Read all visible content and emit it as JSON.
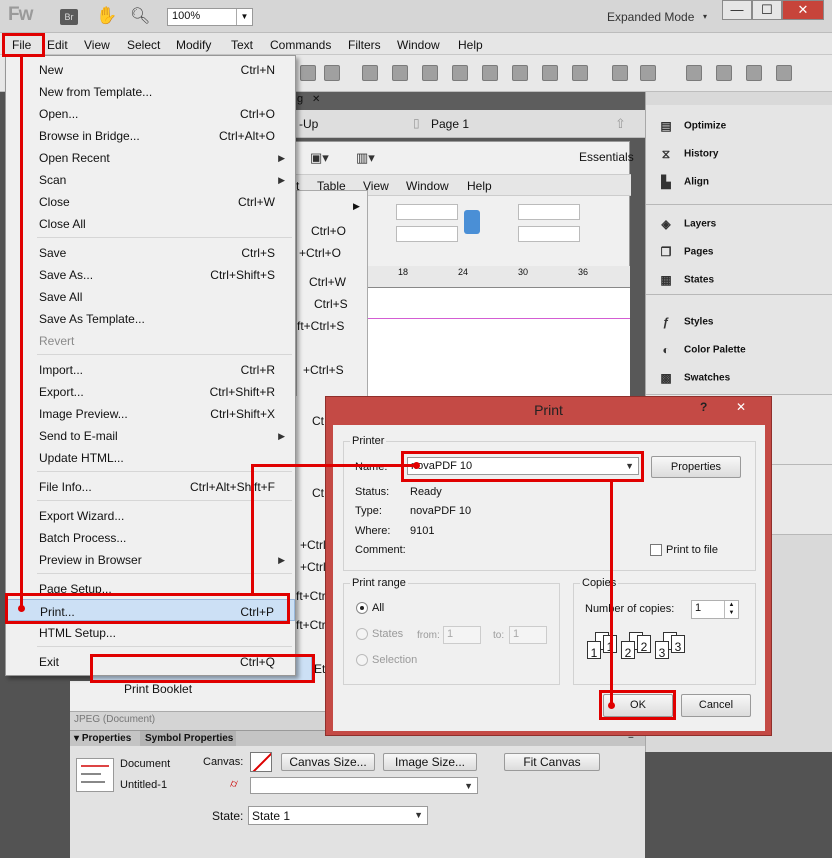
{
  "app": {
    "logo": "Fw",
    "bridge_badge": "Br",
    "zoom": "100%",
    "workspace_mode": "Expanded Mode",
    "window_buttons": {
      "minimize": "—",
      "maximize": "☐",
      "close": "✕"
    }
  },
  "menubar": [
    "File",
    "Edit",
    "View",
    "Select",
    "Modify",
    "Text",
    "Commands",
    "Filters",
    "Window",
    "Help"
  ],
  "file_menu": {
    "groups": [
      [
        {
          "label": "New",
          "shortcut": "Ctrl+N"
        },
        {
          "label": "New from Template...",
          "shortcut": ""
        },
        {
          "label": "Open...",
          "shortcut": "Ctrl+O"
        },
        {
          "label": "Browse in Bridge...",
          "shortcut": "Ctrl+Alt+O"
        },
        {
          "label": "Open Recent",
          "shortcut": "",
          "submenu": true
        },
        {
          "label": "Scan",
          "shortcut": "",
          "submenu": true
        },
        {
          "label": "Close",
          "shortcut": "Ctrl+W"
        },
        {
          "label": "Close All",
          "shortcut": ""
        }
      ],
      [
        {
          "label": "Save",
          "shortcut": "Ctrl+S"
        },
        {
          "label": "Save As...",
          "shortcut": "Ctrl+Shift+S"
        },
        {
          "label": "Save All",
          "shortcut": ""
        },
        {
          "label": "Save As Template...",
          "shortcut": ""
        },
        {
          "label": "Revert",
          "shortcut": "",
          "disabled": true
        }
      ],
      [
        {
          "label": "Import...",
          "shortcut": "Ctrl+R"
        },
        {
          "label": "Export...",
          "shortcut": "Ctrl+Shift+R"
        },
        {
          "label": "Image Preview...",
          "shortcut": "Ctrl+Shift+X"
        },
        {
          "label": "Send to E-mail",
          "shortcut": "",
          "submenu": true
        },
        {
          "label": "Update HTML...",
          "shortcut": ""
        }
      ],
      [
        {
          "label": "File Info...",
          "shortcut": "Ctrl+Alt+Shift+F"
        }
      ],
      [
        {
          "label": "Export Wizard...",
          "shortcut": ""
        },
        {
          "label": "Batch Process...",
          "shortcut": ""
        },
        {
          "label": "Preview in Browser",
          "shortcut": "",
          "submenu": true
        }
      ],
      [
        {
          "label": "Page Setup...",
          "shortcut": ""
        },
        {
          "label": "Print...",
          "shortcut": "Ctrl+P",
          "highlighted": true
        },
        {
          "label": "HTML Setup...",
          "shortcut": ""
        }
      ],
      [
        {
          "label": "Exit",
          "shortcut": "Ctrl+Q"
        }
      ]
    ]
  },
  "background_window": {
    "doc_tab_close": "✕",
    "tab_fragment": "g",
    "popup_fragment": "-Up",
    "page": "Page 1",
    "essentials": "Essentials",
    "menu_fragments": [
      "t",
      "Table",
      "View",
      "Window",
      "Help"
    ],
    "ruler_ticks": [
      "18",
      "24",
      "30",
      "36"
    ],
    "menu_shortcuts": [
      "Ctrl+O",
      "+Ctrl+O",
      "Ctrl+W",
      "Ctrl+S",
      "ft+Ctrl+S",
      "+Ctrl+S",
      "Ct",
      "Ct",
      "+Ctrl+C",
      "+Ctrl+C",
      "ft+Ctrl+C",
      "ft+Ctrl+C",
      "Et"
    ],
    "print_booklet": "Print Booklet",
    "status": "JPEG (Document)"
  },
  "right_panel": {
    "group1": [
      "Optimize",
      "History",
      "Align"
    ],
    "group2": [
      "Layers",
      "Pages",
      "States"
    ],
    "group3": [
      "Styles",
      "Color Palette",
      "Swatches"
    ]
  },
  "properties": {
    "tabs": [
      "Properties",
      "Symbol Properties"
    ],
    "doc_type": "Document",
    "doc_name": "Untitled-1",
    "canvas_label": "Canvas:",
    "canvas_size_btn": "Canvas Size...",
    "image_size_btn": "Image Size...",
    "fit_canvas_btn": "Fit Canvas",
    "state_label": "State:",
    "state_value": "State 1"
  },
  "print_dialog": {
    "title": "Print",
    "help": "?",
    "close": "✕",
    "printer_group": "Printer",
    "name_label": "Name:",
    "name_value": "novaPDF 10",
    "properties_btn": "Properties",
    "status_label": "Status:",
    "status_value": "Ready",
    "type_label": "Type:",
    "type_value": "novaPDF 10",
    "where_label": "Where:",
    "where_value": "9101",
    "comment_label": "Comment:",
    "print_to_file": "Print to file",
    "range_group": "Print range",
    "range_all": "All",
    "range_states": "States",
    "from_label": "from:",
    "from_value": "1",
    "to_label": "to:",
    "to_value": "1",
    "range_selection": "Selection",
    "copies_group": "Copies",
    "copies_label": "Number of copies:",
    "copies_value": "1",
    "collate_pages": [
      "1",
      "1",
      "2",
      "2",
      "3",
      "3"
    ],
    "ok": "OK",
    "cancel": "Cancel"
  },
  "colors": {
    "annotation": "#e00000",
    "dialog_frame": "#c44a45",
    "menu_highlight": "#cce0f5"
  }
}
